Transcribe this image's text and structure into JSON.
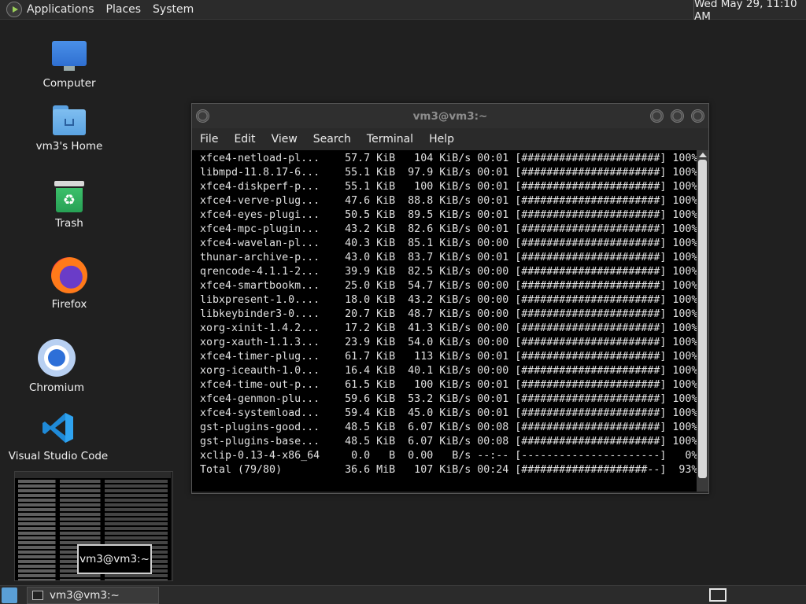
{
  "top_panel": {
    "menus": [
      "Applications",
      "Places",
      "System"
    ],
    "clock": "Wed May 29, 11:10 AM"
  },
  "desktop_icons": {
    "computer": "Computer",
    "home": "vm3's Home",
    "trash": "Trash",
    "firefox": "Firefox",
    "chromium": "Chromium",
    "vscode": "Visual Studio Code"
  },
  "terminal": {
    "title": "vm3@vm3:~",
    "menu": [
      "File",
      "Edit",
      "View",
      "Search",
      "Terminal",
      "Help"
    ],
    "lines": [
      "xfce4-netload-pl...    57.7 KiB   104 KiB/s 00:01 [######################] 100%",
      "libmpd-11.8.17-6...    55.1 KiB  97.9 KiB/s 00:01 [######################] 100%",
      "xfce4-diskperf-p...    55.1 KiB   100 KiB/s 00:01 [######################] 100%",
      "xfce4-verve-plug...    47.6 KiB  88.8 KiB/s 00:01 [######################] 100%",
      "xfce4-eyes-plugi...    50.5 KiB  89.5 KiB/s 00:01 [######################] 100%",
      "xfce4-mpc-plugin...    43.2 KiB  82.6 KiB/s 00:01 [######################] 100%",
      "xfce4-wavelan-pl...    40.3 KiB  85.1 KiB/s 00:00 [######################] 100%",
      "thunar-archive-p...    43.0 KiB  83.7 KiB/s 00:01 [######################] 100%",
      "qrencode-4.1.1-2...    39.9 KiB  82.5 KiB/s 00:00 [######################] 100%",
      "xfce4-smartbookm...    25.0 KiB  54.7 KiB/s 00:00 [######################] 100%",
      "libxpresent-1.0....    18.0 KiB  43.2 KiB/s 00:00 [######################] 100%",
      "libkeybinder3-0....    20.7 KiB  48.7 KiB/s 00:00 [######################] 100%",
      "xorg-xinit-1.4.2...    17.2 KiB  41.3 KiB/s 00:00 [######################] 100%",
      "xorg-xauth-1.1.3...    23.9 KiB  54.0 KiB/s 00:00 [######################] 100%",
      "xfce4-timer-plug...    61.7 KiB   113 KiB/s 00:01 [######################] 100%",
      "xorg-iceauth-1.0...    16.4 KiB  40.1 KiB/s 00:00 [######################] 100%",
      "xfce4-time-out-p...    61.5 KiB   100 KiB/s 00:01 [######################] 100%",
      "xfce4-genmon-plu...    59.6 KiB  53.2 KiB/s 00:01 [######################] 100%",
      "xfce4-systemload...    59.4 KiB  45.0 KiB/s 00:01 [######################] 100%",
      "gst-plugins-good...    48.5 KiB  6.07 KiB/s 00:08 [######################] 100%",
      "gst-plugins-base...    48.5 KiB  6.07 KiB/s 00:08 [######################] 100%",
      "xclip-0.13-4-x86_64     0.0   B  0.00   B/s --:-- [----------------------]   0%",
      "Total (79/80)          36.6 MiB   107 KiB/s 00:24 [####################--]  93%"
    ]
  },
  "workspace_preview": {
    "tooltip": "vm3@vm3:~"
  },
  "bottom_panel": {
    "task_label": "vm3@vm3:~"
  }
}
